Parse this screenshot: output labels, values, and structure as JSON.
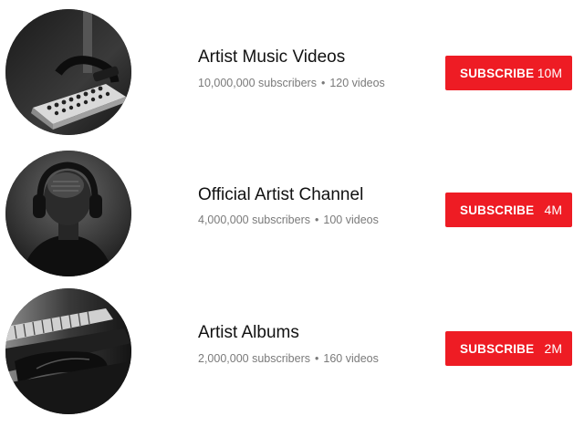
{
  "channels": [
    {
      "name": "Artist Music Videos",
      "subscribers": "10,000,000 subscribers",
      "videos": "120 videos",
      "subscribe_label": "SUBSCRIBE",
      "subscribe_count": "10M",
      "avatar_icon": "mixing-console-photo"
    },
    {
      "name": "Official Artist Channel",
      "subscribers": "4,000,000 subscribers",
      "videos": "100 videos",
      "subscribe_label": "SUBSCRIBE",
      "subscribe_count": "4M",
      "avatar_icon": "headphones-person-photo"
    },
    {
      "name": "Artist Albums",
      "subscribers": "2,000,000 subscribers",
      "videos": "160 videos",
      "subscribe_label": "SUBSCRIBE",
      "subscribe_count": "2M",
      "avatar_icon": "keyboard-hands-photo"
    }
  ],
  "separator": "•",
  "colors": {
    "subscribe_button": "#ee1c24",
    "title_text": "#111111",
    "meta_text": "#7a7a7a"
  }
}
